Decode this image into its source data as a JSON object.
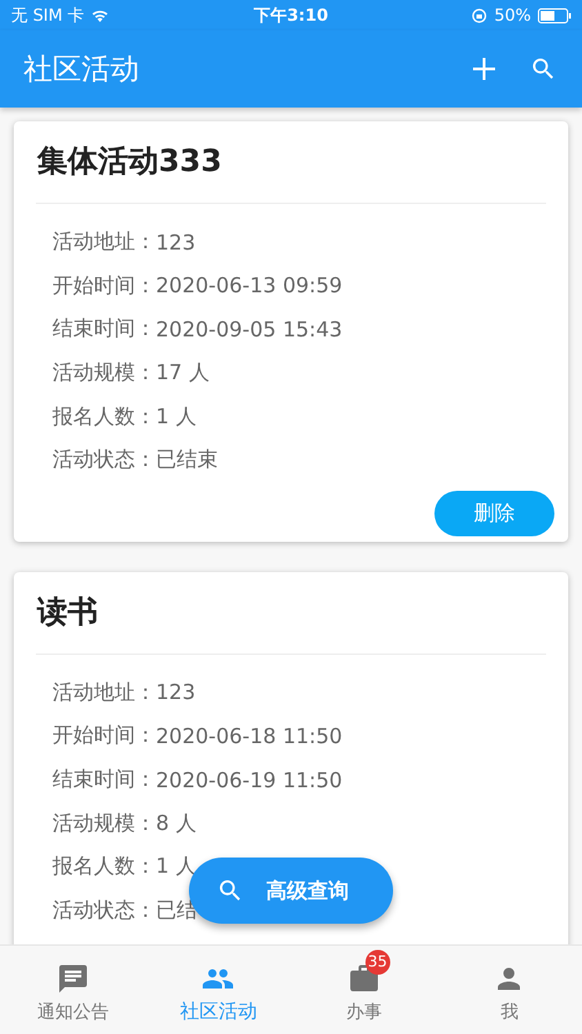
{
  "status_bar": {
    "carrier": "无 SIM 卡",
    "time": "下午3:10",
    "battery": "50%"
  },
  "app_bar": {
    "title": "社区活动"
  },
  "cards": [
    {
      "title": "集体活动333",
      "fields": [
        {
          "label": "活动地址：",
          "value": "123"
        },
        {
          "label": "开始时间：",
          "value": "2020-06-13 09:59"
        },
        {
          "label": "结束时间：",
          "value": "2020-09-05 15:43"
        },
        {
          "label": "活动规模：",
          "value": "17 人"
        },
        {
          "label": "报名人数：",
          "value": "1 人"
        },
        {
          "label": "活动状态：",
          "value": "已结束"
        }
      ],
      "action": "删除"
    },
    {
      "title": "读书",
      "fields": [
        {
          "label": "活动地址：",
          "value": "123"
        },
        {
          "label": "开始时间：",
          "value": "2020-06-18 11:50"
        },
        {
          "label": "结束时间：",
          "value": "2020-06-19 11:50"
        },
        {
          "label": "活动规模：",
          "value": "8 人"
        },
        {
          "label": "报名人数：",
          "value": "1 人"
        },
        {
          "label": "活动状态：",
          "value": "已结"
        }
      ]
    }
  ],
  "fab": {
    "label": "高级查询"
  },
  "tabs": [
    {
      "kind": "notice",
      "label": "通知公告",
      "selected": false
    },
    {
      "kind": "community",
      "label": "社区活动",
      "selected": true
    },
    {
      "kind": "work",
      "label": "办事",
      "selected": false,
      "badge": "35"
    },
    {
      "kind": "me",
      "label": "我",
      "selected": false
    }
  ]
}
